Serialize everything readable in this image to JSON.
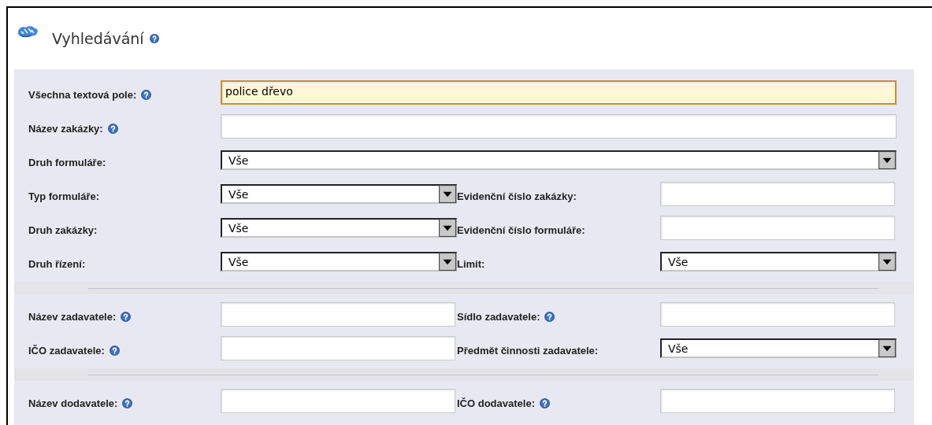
{
  "header": {
    "title": "Vyhledávání",
    "help": true
  },
  "sections": [
    {
      "rows": [
        {
          "fields": [
            {
              "kind": "text",
              "label": "Všechna textová pole:",
              "help": true,
              "value": "police dřevo",
              "focused": true,
              "wide": true
            }
          ]
        },
        {
          "fields": [
            {
              "kind": "text",
              "label": "Název zakázky:",
              "help": true,
              "wide": true
            }
          ]
        },
        {
          "fields": [
            {
              "kind": "select",
              "label": "Druh formuláře:",
              "value": "Vše",
              "wide": true
            }
          ]
        },
        {
          "fields": [
            {
              "kind": "select",
              "label": "Typ formuláře:",
              "value": "Vše"
            },
            {
              "kind": "text",
              "label": "Evidenční číslo zakázky:"
            }
          ]
        },
        {
          "fields": [
            {
              "kind": "select",
              "label": "Druh zakázky:",
              "value": "Vše"
            },
            {
              "kind": "text",
              "label": "Evidenční číslo formuláře:"
            }
          ]
        },
        {
          "fields": [
            {
              "kind": "select",
              "label": "Druh řízení:",
              "value": "Vše"
            },
            {
              "kind": "select",
              "label": "Limit:",
              "value": "Vše"
            }
          ]
        }
      ]
    },
    {
      "rows": [
        {
          "fields": [
            {
              "kind": "text",
              "label": "Název zadavatele:",
              "help": true
            },
            {
              "kind": "text",
              "label": "Sídlo zadavatele:",
              "help": true
            }
          ]
        },
        {
          "fields": [
            {
              "kind": "text",
              "label": "IČO zadavatele:",
              "help": true
            },
            {
              "kind": "select",
              "label": "Předmět činnosti zadavatele:",
              "value": "Vše"
            }
          ]
        }
      ]
    },
    {
      "rows": [
        {
          "fields": [
            {
              "kind": "text",
              "label": "Název dodavatele:",
              "help": true
            },
            {
              "kind": "text",
              "label": "IČO dodavatele:",
              "help": true
            }
          ]
        }
      ]
    }
  ]
}
